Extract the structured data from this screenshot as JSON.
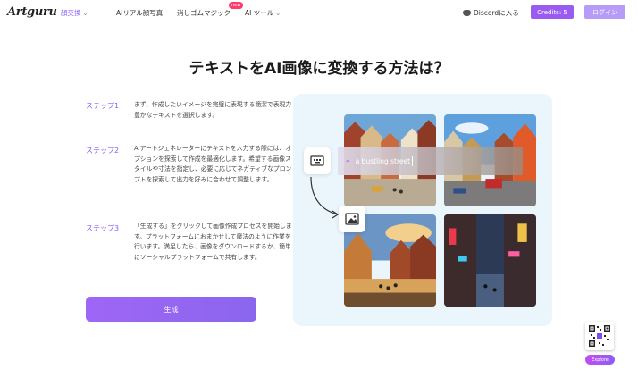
{
  "nav": {
    "logo": "Artguru",
    "items": [
      {
        "label": "顔交換",
        "dropdown": true,
        "active": true
      },
      {
        "label": "AIリアル顔写真",
        "dropdown": false,
        "active": false
      },
      {
        "label": "消しゴムマジック",
        "dropdown": false,
        "active": false,
        "badge": "new"
      },
      {
        "label": "AI ツール",
        "dropdown": true,
        "active": false
      }
    ],
    "discord_label": "Discordに入る",
    "credits_label": "Credits: 5",
    "login_label": "ログイン"
  },
  "title": "テキストをAI画像に変換する方法は？",
  "steps": [
    {
      "label": "ステップ1",
      "text": "まず、作成したいイメージを完璧に表現する簡潔で表現力豊かなテキストを選択します。"
    },
    {
      "label": "ステップ2",
      "text": "AIアートジェネレーターにテキストを入力する際には、オプションを探索して作成を最適化します。希望する画像スタイルや寸法を指定し、必要に応じてネガティブなプロンプトを探索して出力を好みに合わせて調整します。"
    },
    {
      "label": "ステップ3",
      "text": "「生成する」をクリックして画像作成プロセスを開始します。プラットフォームにおまかせして魔法のように作業を行います。満足したら、画像をダウンロードするか、簡単にソーシャルプラットフォームで共有します。"
    }
  ],
  "generate_label": "生成",
  "showcase": {
    "prompt_text": "a bustling street",
    "text_icon": "text-input-icon",
    "image_icon": "image-icon"
  },
  "floating": {
    "explore_label": "Explore"
  },
  "colors": {
    "accent": "#8a5cf6",
    "panel": "#eaf6fb",
    "badge": "#ff3b6b"
  }
}
